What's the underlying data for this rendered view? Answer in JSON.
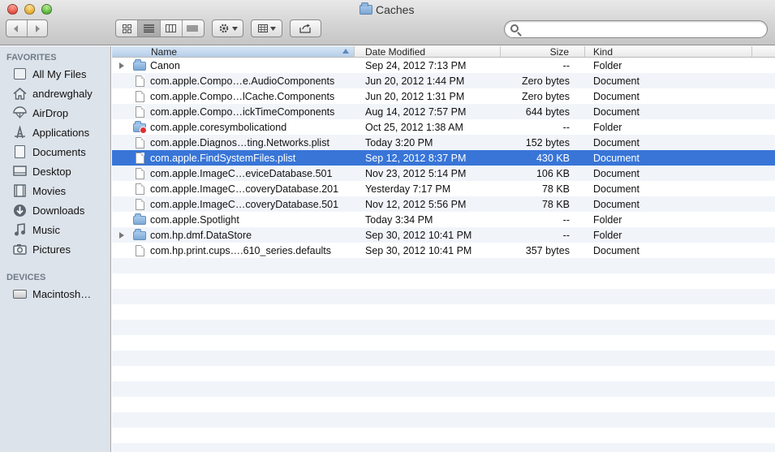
{
  "window": {
    "title": "Caches"
  },
  "toolbar": {
    "back_icon": "chevron-left-icon",
    "forward_icon": "chevron-right-icon",
    "view_modes": [
      "icon-view-icon",
      "list-view-icon",
      "column-view-icon",
      "cover-flow-icon"
    ],
    "active_view": "list-view-icon",
    "action_icon": "gear-icon",
    "arrange_icon": "arrange-grid-icon",
    "share_icon": "share-icon",
    "search": {
      "placeholder": "",
      "value": ""
    }
  },
  "sidebar": {
    "favorites_header": "FAVORITES",
    "favorites": [
      {
        "label": "All My Files",
        "icon": "all-files-icon"
      },
      {
        "label": "andrewghaly",
        "icon": "home-icon"
      },
      {
        "label": "AirDrop",
        "icon": "airdrop-icon"
      },
      {
        "label": "Applications",
        "icon": "applications-icon"
      },
      {
        "label": "Documents",
        "icon": "documents-icon"
      },
      {
        "label": "Desktop",
        "icon": "desktop-icon"
      },
      {
        "label": "Movies",
        "icon": "movies-icon"
      },
      {
        "label": "Downloads",
        "icon": "downloads-icon"
      },
      {
        "label": "Music",
        "icon": "music-icon"
      },
      {
        "label": "Pictures",
        "icon": "pictures-icon"
      }
    ],
    "devices_header": "DEVICES",
    "devices": [
      {
        "label": "Macintosh…",
        "icon": "hard-disk-icon"
      }
    ]
  },
  "list": {
    "columns": {
      "name": "Name",
      "date": "Date Modified",
      "size": "Size",
      "kind": "Kind"
    },
    "selection_color": "#3875d7",
    "rows": [
      {
        "name": "Canon",
        "date": "Sep 24, 2012 7:13 PM",
        "size": "--",
        "kind": "Folder",
        "type": "folder",
        "expandable": true
      },
      {
        "name": "com.apple.Compo…e.AudioComponents",
        "date": "Jun 20, 2012 1:44 PM",
        "size": "Zero bytes",
        "kind": "Document",
        "type": "doc"
      },
      {
        "name": "com.apple.Compo…lCache.Components",
        "date": "Jun 20, 2012 1:31 PM",
        "size": "Zero bytes",
        "kind": "Document",
        "type": "doc"
      },
      {
        "name": "com.apple.Compo…ickTimeComponents",
        "date": "Aug 14, 2012 7:57 PM",
        "size": "644 bytes",
        "kind": "Document",
        "type": "doc"
      },
      {
        "name": "com.apple.coresymbolicationd",
        "date": "Oct 25, 2012 1:38 AM",
        "size": "--",
        "kind": "Folder",
        "type": "folder-badge"
      },
      {
        "name": "com.apple.Diagnos…ting.Networks.plist",
        "date": "Today 3:20 PM",
        "size": "152 bytes",
        "kind": "Document",
        "type": "doc"
      },
      {
        "name": "com.apple.FindSystemFiles.plist",
        "date": "Sep 12, 2012 8:37 PM",
        "size": "430 KB",
        "kind": "Document",
        "type": "doc",
        "selected": true
      },
      {
        "name": "com.apple.ImageC…eviceDatabase.501",
        "date": "Nov 23, 2012 5:14 PM",
        "size": "106 KB",
        "kind": "Document",
        "type": "doc"
      },
      {
        "name": "com.apple.ImageC…coveryDatabase.201",
        "date": "Yesterday 7:17 PM",
        "size": "78 KB",
        "kind": "Document",
        "type": "doc"
      },
      {
        "name": "com.apple.ImageC…coveryDatabase.501",
        "date": "Nov 12, 2012 5:56 PM",
        "size": "78 KB",
        "kind": "Document",
        "type": "doc"
      },
      {
        "name": "com.apple.Spotlight",
        "date": "Today 3:34 PM",
        "size": "--",
        "kind": "Folder",
        "type": "folder"
      },
      {
        "name": "com.hp.dmf.DataStore",
        "date": "Sep 30, 2012 10:41 PM",
        "size": "--",
        "kind": "Folder",
        "type": "folder",
        "expandable": true
      },
      {
        "name": "com.hp.print.cups….610_series.defaults",
        "date": "Sep 30, 2012 10:41 PM",
        "size": "357 bytes",
        "kind": "Document",
        "type": "doc"
      }
    ]
  }
}
